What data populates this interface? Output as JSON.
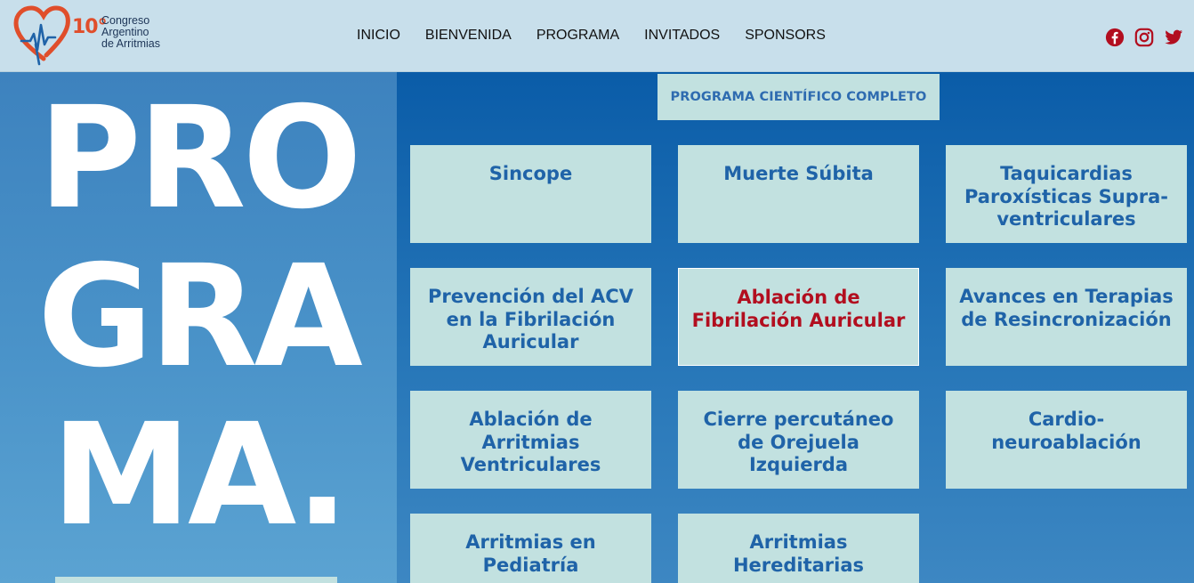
{
  "header": {
    "logo": {
      "number": "10°",
      "line1": "Congreso",
      "line2": "Argentino",
      "line3": "de Arritmias"
    },
    "nav": [
      "INICIO",
      "BIENVENIDA",
      "PROGRAMA",
      "INVITADOS",
      "SPONSORS"
    ],
    "social": [
      "facebook-icon",
      "instagram-icon",
      "twitter-icon"
    ]
  },
  "hero": {
    "line1": "PRO",
    "line2": "GRA",
    "line3": "MA."
  },
  "main": {
    "full_program_button": "PROGRAMA CIENTÍFICO COMPLETO",
    "topics": [
      {
        "label": "Sincope"
      },
      {
        "label": "Muerte Súbita"
      },
      {
        "label": "Taquicardias Paroxísticas Supra-ventriculares"
      },
      {
        "label": "Prevención del ACV en la Fibrilación Auricular"
      },
      {
        "label": "Ablación de Fibrilación Auricular"
      },
      {
        "label": "Avances en Terapias de Resincronización"
      },
      {
        "label": "Ablación de Arritmias Ventriculares"
      },
      {
        "label": "Cierre percutáneo de Orejuela Izquierda"
      },
      {
        "label": "Cardio-neuroablación"
      },
      {
        "label": "Arritmias en Pediatría"
      },
      {
        "label": "Arritmias Hereditarias"
      }
    ]
  },
  "colors": {
    "header_bg": "#c8dfeb",
    "card_bg": "#c2e1e0",
    "card_text": "#1f63a8",
    "active_text": "#b20e1f",
    "social": "#b20e1f",
    "logo_accent": "#e04e2b"
  }
}
